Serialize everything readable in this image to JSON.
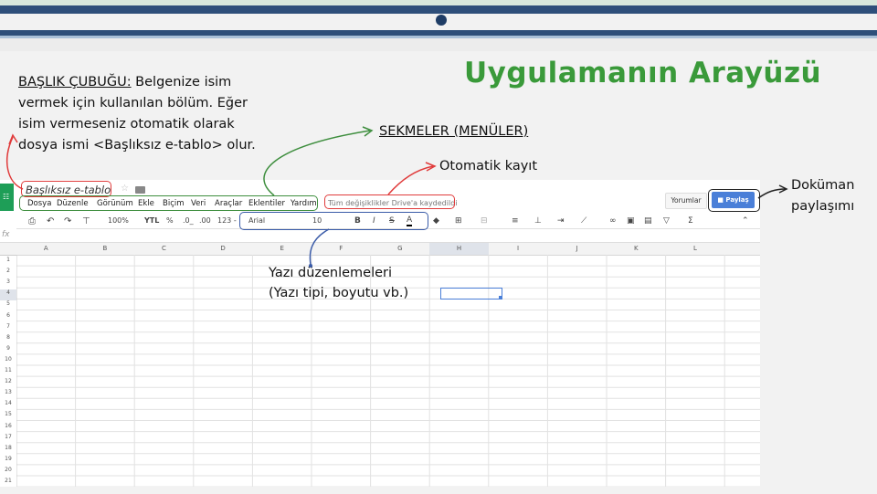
{
  "slide": {
    "title": "Uygulamanın Arayüzü",
    "note_title_heading": "BAŞLIK ÇUBUĞU:",
    "note_title_lines": [
      " Belgenize isim",
      "vermek için kullanılan bölüm. Eğer",
      "isim vermeseniz otomatik olarak",
      "dosya ismi <Başlıksız e-tablo> olur."
    ],
    "note_tabs": "SEKMELER (MENÜLER)",
    "note_autosave": "Otomatik kayıt",
    "note_share_lines": [
      "Doküman",
      "paylaşımı"
    ],
    "note_format_lines": [
      "Yazı düzenlemeleri",
      "(Yazı tipi, boyutu vb.)"
    ]
  },
  "sheet": {
    "doc_title": "Başlıksız e-tablo",
    "menus": [
      "Dosya",
      "Düzenle",
      "Görünüm",
      "Ekle",
      "Biçim",
      "Veri",
      "Araçlar",
      "Eklentiler",
      "Yardım"
    ],
    "save_status": "Tüm değişiklikler Drive'a kaydedildi",
    "comments_label": "Yorumlar",
    "share_label": "Paylaş",
    "toolbar": {
      "zoom": "100%",
      "currency": "YTL",
      "percent": "%",
      "dec_less": ".0_",
      "dec_more": ".00",
      "format_more": "123 -",
      "font": "Arial",
      "size": "10",
      "bold": "B",
      "italic": "I",
      "strike": "S",
      "text_color": "A",
      "sum": "Σ"
    },
    "fx_label": "fx",
    "columns": [
      "A",
      "B",
      "C",
      "D",
      "E",
      "F",
      "G",
      "H",
      "I",
      "J",
      "K",
      "L"
    ],
    "rows": [
      "1",
      "2",
      "3",
      "4",
      "5",
      "6",
      "7",
      "8",
      "9",
      "10",
      "11",
      "12",
      "13",
      "14",
      "15",
      "16",
      "17",
      "18",
      "19",
      "20",
      "21"
    ],
    "selected_cell": "H4"
  },
  "colors": {
    "title_green": "#3a9a3a",
    "red_annotation": "#e03b3b",
    "green_annotation": "#3e8e3e",
    "blue_annotation": "#3a5ba8",
    "share_blue": "#4a7fd8",
    "stripe_navy": "#2e4f7a"
  }
}
